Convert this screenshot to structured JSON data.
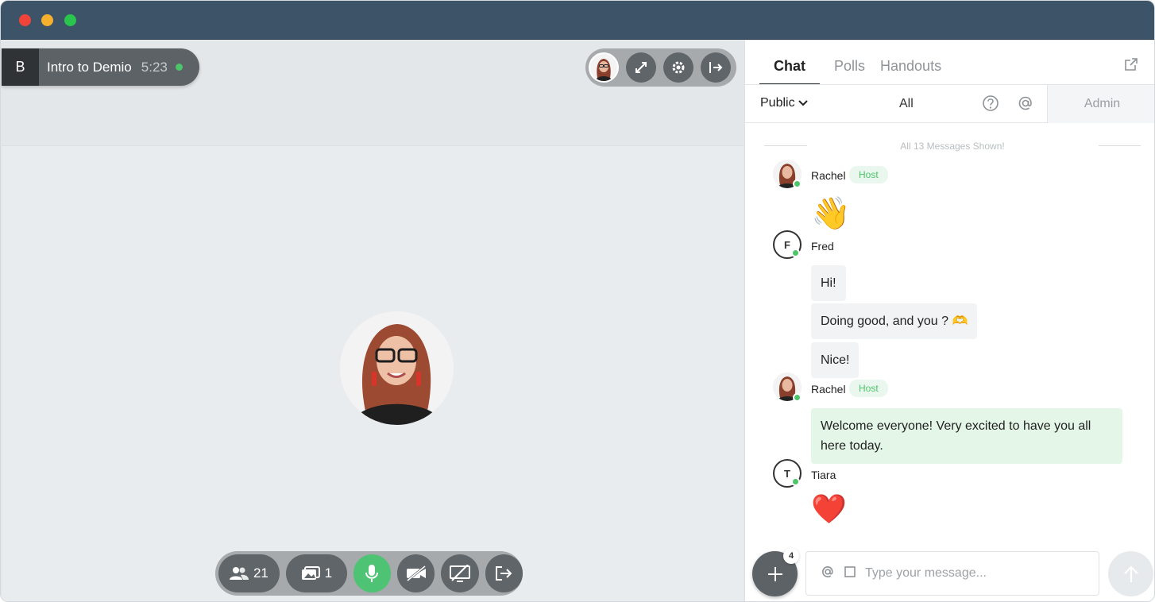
{
  "session": {
    "letter": "B",
    "name": "Intro to Demio",
    "time": "5:23"
  },
  "top_controls": {
    "icons": [
      "host-avatar",
      "fullscreen-icon",
      "gear-icon",
      "exit-panel-icon"
    ]
  },
  "bottom_bar": {
    "attendees_count": "21",
    "media_count": "1"
  },
  "chat": {
    "tabs": [
      "Chat",
      "Polls",
      "Handouts"
    ],
    "filter_public": "Public",
    "filter_all": "All",
    "admin_label": "Admin",
    "shown_text": "All 13 Messages Shown!",
    "host_badge": "Host",
    "messages": [
      {
        "author": "Rachel",
        "initial": "",
        "text": "👋"
      },
      {
        "author": "Fred",
        "initial": "F",
        "texts": [
          "Hi!",
          "Doing good, and you ? 🫶",
          "Nice!"
        ]
      },
      {
        "author": "Rachel",
        "initial": "",
        "text": "Welcome everyone! Very excited to have you all here today."
      },
      {
        "author": "Tiara",
        "initial": "T",
        "text": "❤️"
      }
    ],
    "plus_count": "4",
    "input_placeholder": "Type your message..."
  },
  "colors": {
    "titlebar": "#3d5468",
    "accent_green": "#4ec373",
    "host_bubble": "#e3f6e7"
  }
}
